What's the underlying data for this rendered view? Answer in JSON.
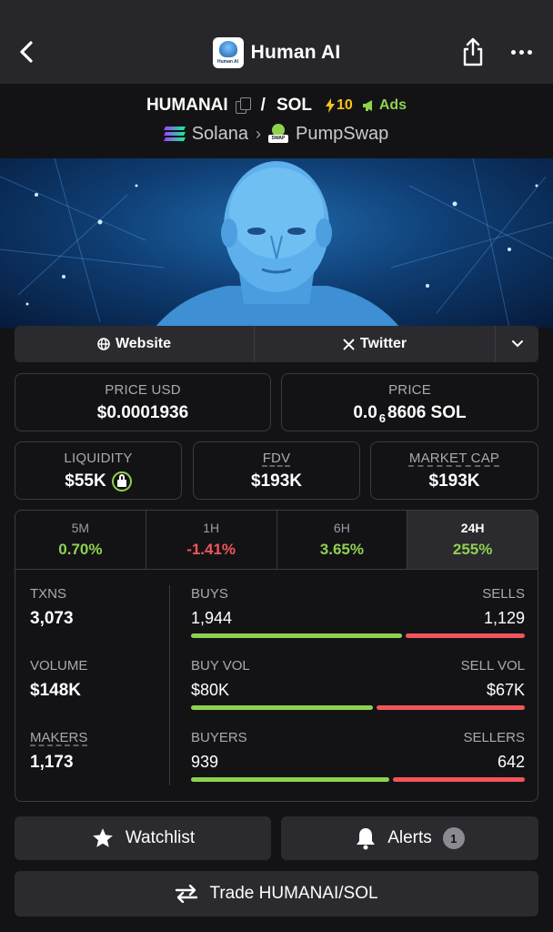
{
  "header": {
    "title": "Human AI",
    "logo_caption": "Human AI"
  },
  "pair": {
    "base": "HUMANAI",
    "separator": "/",
    "quote": "SOL",
    "boost_count": "10",
    "ads_label": "Ads",
    "chain": "Solana",
    "dex": "PumpSwap",
    "dex_badge": "SWAP"
  },
  "links": {
    "website": "Website",
    "twitter": "Twitter"
  },
  "prices": {
    "usd_label": "PRICE USD",
    "usd_value": "$0.0001936",
    "native_label": "PRICE",
    "native_prefix": "0.0",
    "native_subscript": "6",
    "native_suffix": "8606 SOL"
  },
  "metrics": {
    "liquidity_label": "LIQUIDITY",
    "liquidity_value": "$55K",
    "fdv_label": "FDV",
    "fdv_value": "$193K",
    "mcap_label": "MARKET CAP",
    "mcap_value": "$193K"
  },
  "timeframes": [
    {
      "label": "5M",
      "change": "0.70%",
      "direction": "up"
    },
    {
      "label": "1H",
      "change": "-1.41%",
      "direction": "down"
    },
    {
      "label": "6H",
      "change": "3.65%",
      "direction": "up"
    },
    {
      "label": "24H",
      "change": "255%",
      "direction": "up",
      "selected": true
    }
  ],
  "stats": {
    "txns_label": "TXNS",
    "txns_value": "3,073",
    "volume_label": "VOLUME",
    "volume_value": "$148K",
    "makers_label": "MAKERS",
    "makers_value": "1,173",
    "buys_label": "BUYS",
    "buys_value": "1,944",
    "sells_label": "SELLS",
    "sells_value": "1,129",
    "buys_fraction": 0.633,
    "buy_vol_label": "BUY VOL",
    "buy_vol_value": "$80K",
    "sell_vol_label": "SELL VOL",
    "sell_vol_value": "$67K",
    "buy_vol_fraction": 0.544,
    "buyers_label": "BUYERS",
    "buyers_value": "939",
    "sellers_label": "SELLERS",
    "sellers_value": "642",
    "buyers_fraction": 0.594
  },
  "actions": {
    "watchlist": "Watchlist",
    "alerts": "Alerts",
    "alerts_count": "1",
    "trade": "Trade HUMANAI/SOL"
  },
  "colors": {
    "positive": "#8fd14f",
    "negative": "#f1565b",
    "boost": "#f5c21b"
  }
}
